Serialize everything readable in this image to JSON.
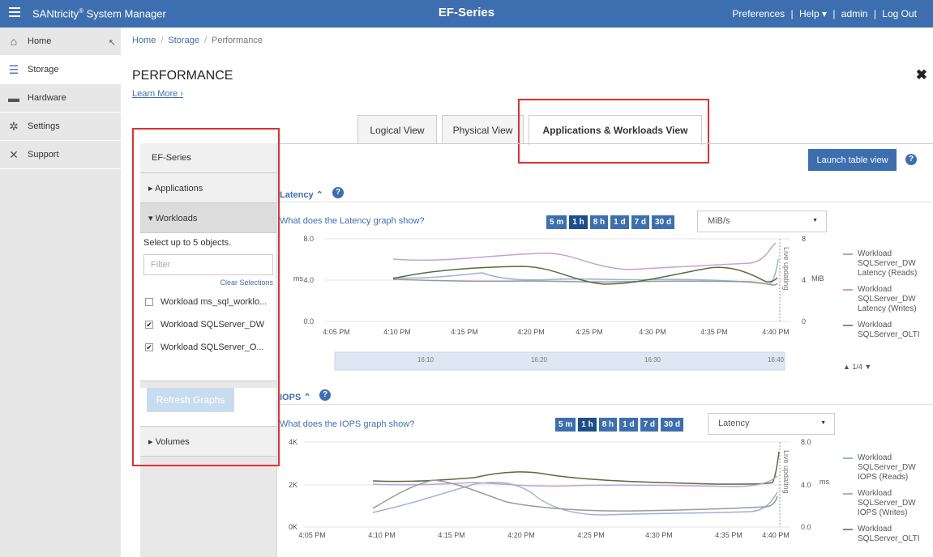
{
  "topbar": {
    "app_title": "SANtricity",
    "app_title_sup": "®",
    "app_title_rest": " System Manager",
    "system_name": "EF-Series",
    "preferences": "Preferences",
    "help": "Help ▾",
    "user": "admin",
    "logout": "Log Out",
    "sep": "|"
  },
  "sidebar": {
    "items": [
      {
        "label": "Home",
        "icon": "home-icon"
      },
      {
        "label": "Storage",
        "icon": "storage-icon"
      },
      {
        "label": "Hardware",
        "icon": "hardware-icon"
      },
      {
        "label": "Settings",
        "icon": "gear-icon"
      },
      {
        "label": "Support",
        "icon": "wrench-icon"
      }
    ]
  },
  "breadcrumb": {
    "home": "Home",
    "storage": "Storage",
    "current": "Performance",
    "sep": "/"
  },
  "page": {
    "title": "PERFORMANCE",
    "learn_more": "Learn More ›",
    "close": "✖"
  },
  "tabs": [
    "Logical View",
    "Physical View",
    "Applications & Workloads View"
  ],
  "left_panel": {
    "header": "EF-Series",
    "applications": "▸ Applications",
    "workloads": "▾ Workloads",
    "hint": "Select up to 5 objects.",
    "filter_placeholder": "Filter",
    "clear_selections": "Clear Selections",
    "objects": [
      {
        "label": "Workload ms_sql_worklo...",
        "checked": false
      },
      {
        "label": "Workload SQLServer_DW",
        "checked": true
      },
      {
        "label": "Workload SQLServer_O...",
        "checked": true
      }
    ],
    "refresh": "Refresh Graphs",
    "volumes": "▸ Volumes"
  },
  "launch_table": "Launch table view",
  "help_glyph": "?",
  "time_buttons": [
    "5 m",
    "1 h",
    "8 h",
    "1 d",
    "7 d",
    "30 d"
  ],
  "latency": {
    "title": "Latency ⌃",
    "what": "What does the Latency graph show?",
    "select": "MiB/s",
    "y_left_ticks": [
      "8.0",
      "4.0",
      "0.0"
    ],
    "y_left_unit": "ms",
    "y_right_ticks": [
      "8",
      "4",
      "0"
    ],
    "y_right_unit": "MiB",
    "x_ticks": [
      "4:05 PM",
      "4:10 PM",
      "4:15 PM",
      "4:20 PM",
      "4:25 PM",
      "4:30 PM",
      "4:35 PM",
      "4:40 PM"
    ],
    "live_label": "Live updating",
    "nav_ticks": [
      "16:10",
      "16:20",
      "16:30",
      "16:40"
    ],
    "legend": [
      {
        "lines": [
          "Workload",
          "SQLServer_DW",
          "Latency (Reads)"
        ],
        "color": "#9ab3d5"
      },
      {
        "lines": [
          "Workload",
          "SQLServer_DW",
          "Latency (Writes)"
        ],
        "color": "#c9a0d2"
      },
      {
        "lines": [
          "Workload",
          "SQLServer_OLTI"
        ],
        "color": "#888888"
      }
    ],
    "pager": "▲ 1/4 ▼"
  },
  "iops": {
    "title": "IOPS ⌃",
    "what": "What does the IOPS graph show?",
    "select": "Latency",
    "y_left_ticks": [
      "4K",
      "2K",
      "0K"
    ],
    "y_right_ticks": [
      "8.0",
      "4.0",
      "0.0"
    ],
    "y_right_unit": "ms",
    "x_ticks": [
      "4:05 PM",
      "4:10 PM",
      "4:15 PM",
      "4:20 PM",
      "4:25 PM",
      "4:30 PM",
      "4:35 PM",
      "4:40 PM"
    ],
    "live_label": "Live updating",
    "legend": [
      {
        "lines": [
          "Workload",
          "SQLServer_DW",
          "IOPS (Reads)"
        ],
        "color": "#9ab3d5"
      },
      {
        "lines": [
          "Workload",
          "SQLServer_DW",
          "IOPS (Writes)"
        ],
        "color": "#c9a0d2"
      },
      {
        "lines": [
          "Workload",
          "SQLServer_OLTI"
        ],
        "color": "#888888"
      }
    ]
  }
}
